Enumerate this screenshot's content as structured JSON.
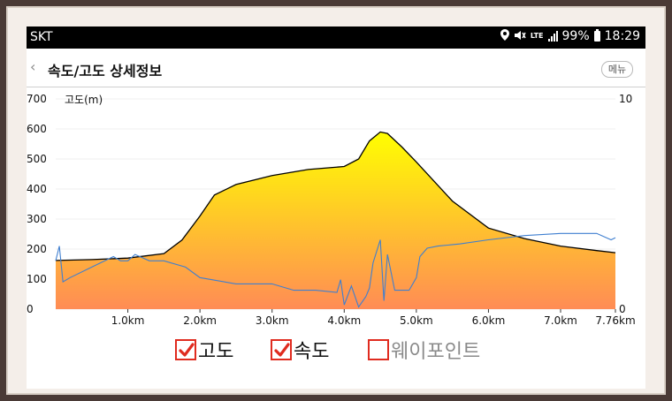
{
  "statusbar": {
    "carrier": "SKT",
    "network": "LTE",
    "battery": "99%",
    "time": "18:29"
  },
  "header": {
    "back_icon": "‹",
    "title": "속도/고도 상세정보",
    "menu_label": "메뉴"
  },
  "chart_data": {
    "type": "area",
    "left_axis_title": "고도(m)",
    "left_axis_ticks": [
      "700",
      "600",
      "500",
      "400",
      "300",
      "200",
      "100",
      "0"
    ],
    "right_axis_ticks": [
      "10",
      "0"
    ],
    "x_ticks": [
      "1.0km",
      "2.0km",
      "3.0km",
      "4.0km",
      "5.0km",
      "6.0km",
      "7.0km",
      "7.76km"
    ],
    "ylim_left": [
      0,
      700
    ],
    "ylim_right": [
      0,
      10
    ],
    "xlim": [
      0,
      7.76
    ],
    "colors": {
      "fill_top": "#ffff00",
      "fill_bottom": "#ff8c55",
      "altitude_line": "#000000",
      "speed_line": "#3f7fd0",
      "axis_title": "#e02b1f"
    },
    "series": [
      {
        "name": "고도",
        "x": [
          0.0,
          0.5,
          1.0,
          1.5,
          1.75,
          2.0,
          2.2,
          2.5,
          3.0,
          3.5,
          4.0,
          4.2,
          4.35,
          4.5,
          4.6,
          4.8,
          5.0,
          5.5,
          6.0,
          6.5,
          7.0,
          7.5,
          7.76
        ],
        "y": [
          162,
          165,
          170,
          185,
          230,
          310,
          380,
          415,
          445,
          465,
          475,
          500,
          560,
          590,
          585,
          540,
          490,
          360,
          270,
          235,
          210,
          195,
          188
        ]
      },
      {
        "name": "속도",
        "x": [
          0.0,
          0.05,
          0.1,
          0.2,
          0.5,
          0.8,
          0.9,
          1.0,
          1.1,
          1.3,
          1.5,
          1.8,
          2.0,
          2.5,
          3.0,
          3.3,
          3.6,
          3.9,
          3.95,
          4.0,
          4.1,
          4.2,
          4.3,
          4.35,
          4.4,
          4.5,
          4.55,
          4.6,
          4.7,
          4.9,
          5.0,
          5.05,
          5.15,
          5.3,
          5.6,
          6.0,
          6.5,
          7.0,
          7.5,
          7.7,
          7.76
        ],
        "y": [
          2.3,
          3.0,
          1.3,
          1.5,
          2.0,
          2.5,
          2.3,
          2.3,
          2.6,
          2.3,
          2.3,
          2.0,
          1.5,
          1.2,
          1.2,
          0.9,
          0.9,
          0.8,
          1.4,
          0.2,
          1.1,
          0.1,
          0.6,
          1.0,
          2.2,
          3.3,
          0.4,
          2.6,
          0.9,
          0.9,
          1.5,
          2.5,
          2.9,
          3.0,
          3.1,
          3.3,
          3.5,
          3.6,
          3.6,
          3.3,
          3.4
        ]
      }
    ]
  },
  "legend": [
    {
      "label": "고도",
      "checked": true
    },
    {
      "label": "속도",
      "checked": true
    },
    {
      "label": "웨이포인트",
      "checked": false
    }
  ]
}
